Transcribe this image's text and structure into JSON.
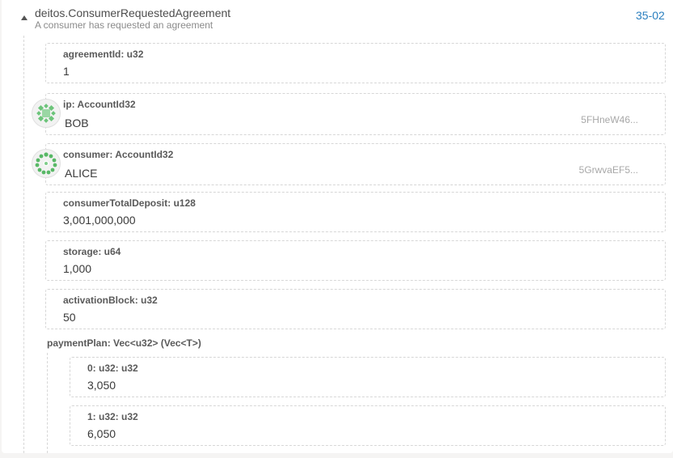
{
  "event": {
    "name": "deitos.ConsumerRequestedAgreement",
    "description": "A consumer has requested an agreement",
    "index": "35-02"
  },
  "fields": [
    {
      "label": "agreementId: u32",
      "value": "1"
    },
    {
      "label": "ip: AccountId32",
      "value": "BOB",
      "address": "5FHneW46..."
    },
    {
      "label": "consumer: AccountId32",
      "value": "ALICE",
      "address": "5GrwvaEF5..."
    },
    {
      "label": "consumerTotalDeposit: u128",
      "value": "3,001,000,000"
    },
    {
      "label": "storage: u64",
      "value": "1,000"
    },
    {
      "label": "activationBlock: u32",
      "value": "50"
    }
  ],
  "paymentPlan": {
    "label": "paymentPlan: Vec<u32> (Vec<T>)",
    "items": [
      {
        "label": "0: u32: u32",
        "value": "3,050"
      },
      {
        "label": "1: u32: u32",
        "value": "6,050"
      }
    ]
  },
  "icons": {
    "collapse": "triangle-up-icon",
    "identicon_bob": "identicon-icon",
    "identicon_alice": "identicon-icon"
  },
  "colors": {
    "accent": "#2a7fbf",
    "identicon_green": "#5bbf6a"
  }
}
